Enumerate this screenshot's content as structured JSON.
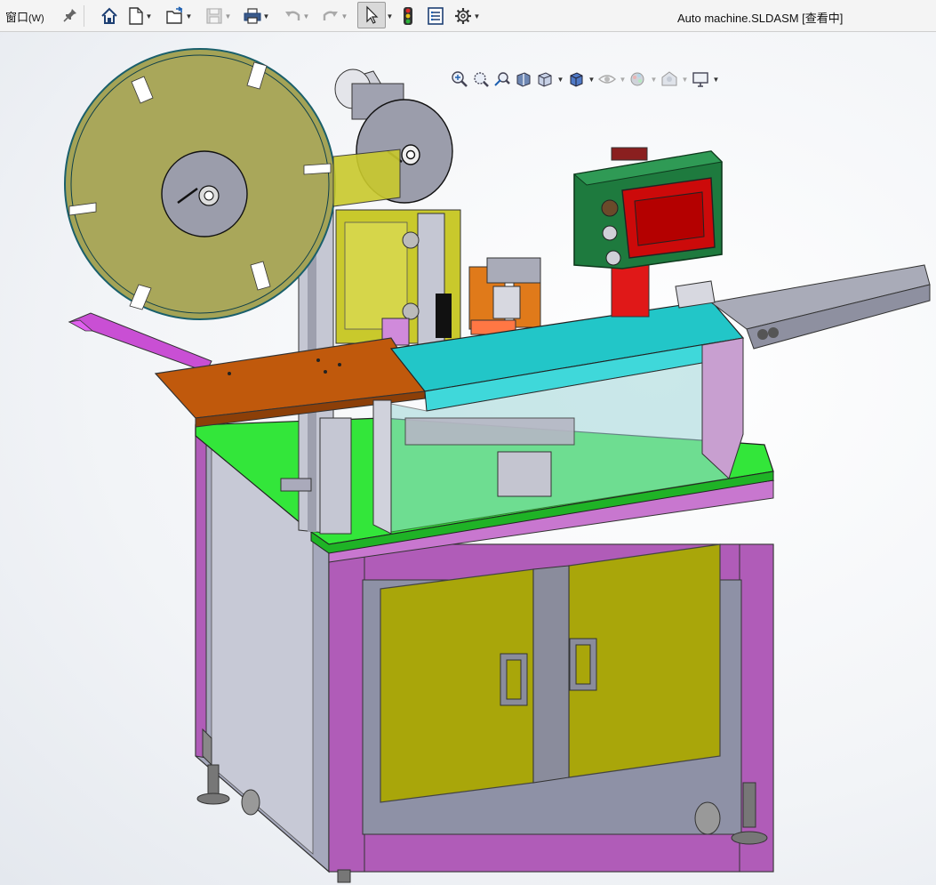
{
  "menu": {
    "window_label": "窗口",
    "window_shortcut": "(W)"
  },
  "document": {
    "title": "Auto machine.SLDASM [查看中]"
  },
  "toolbar": {
    "icons": [
      "home-icon",
      "new-document-icon",
      "open-file-icon",
      "save-icon",
      "print-icon",
      "undo-icon",
      "redo-icon",
      "select-pointer-icon",
      "traffic-light-icon",
      "file-properties-icon",
      "options-gear-icon"
    ]
  },
  "heads_up_toolbar": {
    "icons": [
      "zoom-to-fit-icon",
      "zoom-to-area-icon",
      "previous-view-icon",
      "section-view-icon",
      "view-orientation-icon",
      "display-style-icon",
      "hide-show-items-icon",
      "edit-appearance-icon",
      "apply-scene-icon",
      "view-settings-icon"
    ]
  },
  "colors": {
    "frame_purple": "#b05cb8",
    "cabinet_door": "#a9a60a",
    "top_plate": "#33e63a",
    "cover": "#22c6c8",
    "reel": "#a4a356",
    "orange_plate": "#c0590c",
    "control_box": "#1e7a3e",
    "screen_red": "#cc0a0a"
  }
}
